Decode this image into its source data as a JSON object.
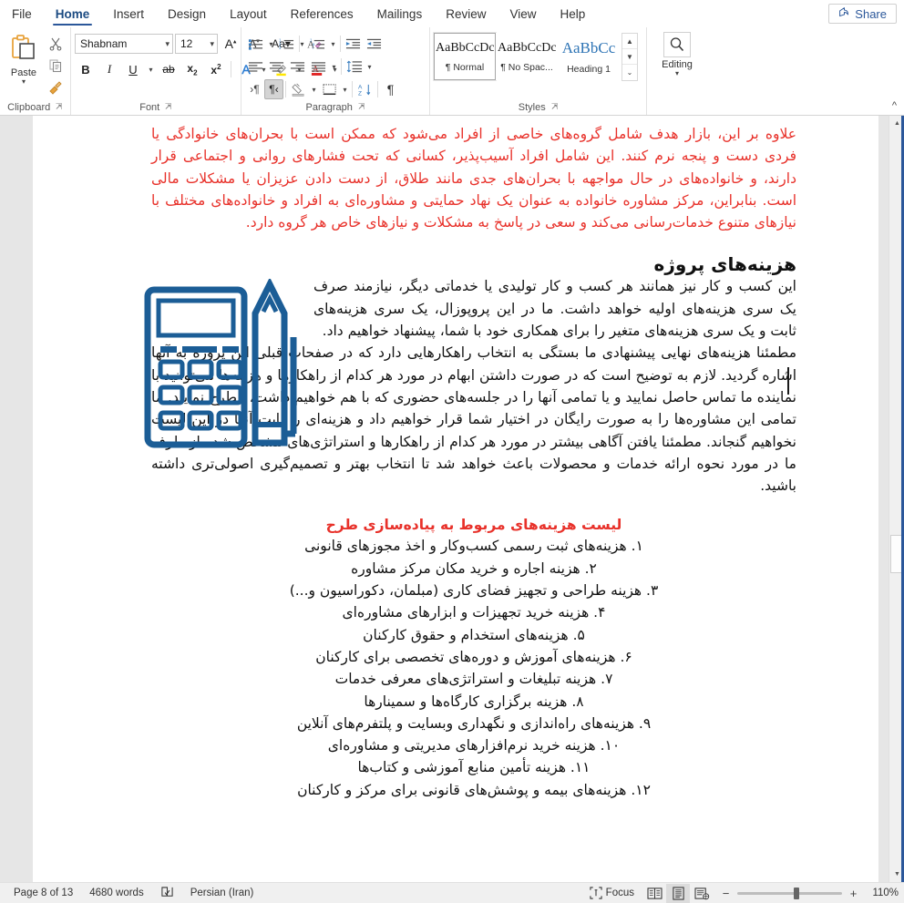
{
  "tabs": [
    {
      "label": "File",
      "active": false
    },
    {
      "label": "Home",
      "active": true
    },
    {
      "label": "Insert",
      "active": false
    },
    {
      "label": "Design",
      "active": false
    },
    {
      "label": "Layout",
      "active": false
    },
    {
      "label": "References",
      "active": false
    },
    {
      "label": "Mailings",
      "active": false
    },
    {
      "label": "Review",
      "active": false
    },
    {
      "label": "View",
      "active": false
    },
    {
      "label": "Help",
      "active": false
    }
  ],
  "share": {
    "label": "Share",
    "icon": "share-person-icon"
  },
  "ribbon": {
    "clipboard": {
      "label": "Clipboard",
      "paste": "Paste",
      "cut_icon": "scissors-icon",
      "copy_icon": "copy-icon",
      "format_painter_icon": "format-painter-icon",
      "launcher": "dialog-launcher-icon"
    },
    "font": {
      "label": "Font",
      "font_name": "Shabnam",
      "font_size": "12",
      "grow_font": "A",
      "shrink_font": "A",
      "change_case": "Aa",
      "clear_formatting_icon": "clear-formatting-icon",
      "bold": "B",
      "italic": "I",
      "underline": "U",
      "strikethrough": "ab",
      "subscript": "x",
      "superscript": "x",
      "text_effects_icon": "text-effects-icon",
      "highlight_icon": "highlight-icon",
      "font_color_icon": "font-color-icon",
      "launcher": "dialog-launcher-icon"
    },
    "paragraph": {
      "label": "Paragraph",
      "bullets_icon": "bullets-icon",
      "numbering_icon": "numbering-icon",
      "multilevel_icon": "multilevel-list-icon",
      "decrease_indent_icon": "decrease-indent-icon",
      "increase_indent_icon": "increase-indent-icon",
      "align_left_icon": "align-left-icon",
      "align_center_icon": "align-center-icon",
      "align_right_icon": "align-right-icon",
      "justify_icon": "justify-icon",
      "line_spacing_icon": "line-spacing-icon",
      "ltr_icon": "ltr-text-direction-icon",
      "rtl_icon": "rtl-text-direction-icon",
      "shading_icon": "shading-icon",
      "borders_icon": "borders-icon",
      "sort_icon": "sort-icon",
      "show_marks_icon": "show-formatting-marks-icon",
      "launcher": "dialog-launcher-icon"
    },
    "styles": {
      "label": "Styles",
      "items": [
        {
          "preview": "AaBbCcDc",
          "name": "¶ Normal",
          "selected": true
        },
        {
          "preview": "AaBbCcDc",
          "name": "¶ No Spac...",
          "selected": false
        },
        {
          "preview": "AaBbCc",
          "name": "Heading 1",
          "selected": false
        }
      ],
      "scroll_up": "▲",
      "scroll_down": "▼",
      "more": "▾",
      "launcher": "dialog-launcher-icon"
    },
    "editing": {
      "label": "Editing",
      "icon": "search-icon",
      "chevron": "⌄"
    },
    "collapse": "⌃"
  },
  "document": {
    "red_intro": "علاوه بر این، بازار هدف شامل گروه‌های خاصی از افراد می‌شود که ممکن است با بحران‌های خانوادگی یا فردی دست و پنجه نرم کنند. این شامل افراد آسیب‌پذیر، کسانی که تحت فشارهای روانی و اجتماعی قرار دارند، و خانواده‌های در حال مواجهه با بحران‌های جدی مانند طلاق، از دست دادن عزیزان یا مشکلات مالی است. بنابراین، مرکز مشاوره خانواده به عنوان یک نهاد حمایتی و مشاوره‌ای به افراد و خانواده‌های مختلف با نیازهای متنوع خدمات‌رسانی می‌کند و سعی در پاسخ به مشکلات و نیازهای خاص هر گروه دارد.",
    "heading": "هزینه‌های پروژه",
    "para1": "این کسب و کار نیز همانند هر کسب و کار تولیدی یا خدماتی دیگر، نیازمند صرف یک سری هزینه‌های اولیه خواهد داشت. ما در این پروپوزال، یک سری هزینه‌های ثابت و یک سری هزینه‌های متغیر را برای همکاری خود با شما، پیشنهاد خواهیم داد.",
    "para2": "مطمئنا هزینه‌های نهایی پیشنهادی ما بستگی به انتخاب راهکارهایی دارد که در صفحات قبلی این پروژه به آنها اشاره گردید. لازم به توضیح است که در صورت داشتن ابهام در مورد هر کدام از راهکارها و هزینه‌ها می‌توانید با نماینده ما تماس حاصل نمایید و یا تمامی آنها را در جلسه‌های حضوری که با هم خواهیم داشت، مطرح نمایید. ما تمامی این مشاوره‌ها را به صورت رایگان در اختیار شما قرار خواهیم داد و هزینه‌ای را بابت آنها در این لیست نخواهیم گنجاند. مطمئنا یافتن آگاهی بیشتر در مورد هر کدام از راهکارها و استراتژی‌های مشخص شده از طرف ما در مورد نحوه ارائه خدمات و محصولات باعث خواهد شد تا انتخاب بهتر و تصمیم‌گیری اصولی‌تری داشته باشید.",
    "list_heading": "لیست هزینه‌های مربوط به پیاده‌سازی طرح",
    "list_items": [
      "۱. هزینه‌های ثبت رسمی کسب‌وکار و اخذ مجوزهای قانونی",
      "۲. هزینه اجاره و خرید مکان مرکز مشاوره",
      "۳. هزینه طراحی و تجهیز فضای کاری (مبلمان، دکوراسیون و...)",
      "۴. هزینه خرید تجهیزات و ابزارهای مشاوره‌ای",
      "۵. هزینه‌های استخدام و حقوق کارکنان",
      "۶. هزینه‌های آموزش و دوره‌های تخصصی برای کارکنان",
      "۷. هزینه تبلیغات و استراتژی‌های معرفی خدمات",
      "۸. هزینه برگزاری کارگاه‌ها و سمینارها",
      "۹. هزینه‌های راه‌اندازی و نگهداری وبسایت و پلتفرم‌های آنلاین",
      "۱۰. هزینه خرید نرم‌افزارهای مدیریتی و مشاوره‌ای",
      "۱۱. هزینه تأمین منابع آموزشی و کتاب‌ها",
      "۱۲. هزینه‌های بیمه و پوشش‌های قانونی برای مرکز و کارکنان"
    ],
    "illustration": "calculator-pencil-icon",
    "illustration_color": "#1b5d96"
  },
  "statusbar": {
    "page": "Page 8 of 13",
    "words": "4680 words",
    "proofing_icon": "proofing-errors-icon",
    "language": "Persian (Iran)",
    "focus": "Focus",
    "focus_icon": "focus-mode-icon",
    "read_mode_icon": "read-mode-icon",
    "print_layout_icon": "print-layout-icon",
    "web_layout_icon": "web-layout-icon",
    "zoom_minus": "−",
    "zoom_plus": "+",
    "zoom_value": "110%"
  },
  "colors": {
    "accent": "#2b579a",
    "red_text": "#e8312a",
    "illustration": "#1b5d96"
  }
}
